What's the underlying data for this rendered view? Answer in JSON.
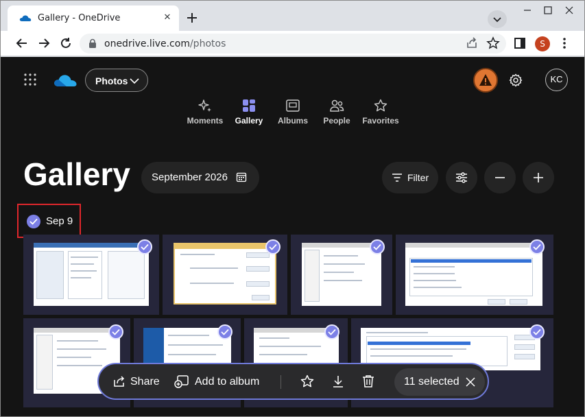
{
  "browser": {
    "tab_title": "Gallery - OneDrive",
    "tab_close_glyph": "✕",
    "url_host": "onedrive.live.com",
    "url_path": "/photos",
    "profile_initial": "S"
  },
  "app": {
    "switcher_label": "Photos",
    "account_initials": "KC",
    "alert_color": "#e07632",
    "accent_color": "#7c80e6"
  },
  "nav": {
    "items": [
      {
        "label": "Moments",
        "icon": "sparkle-icon"
      },
      {
        "label": "Gallery",
        "icon": "grid-icon",
        "active": true
      },
      {
        "label": "Albums",
        "icon": "album-icon"
      },
      {
        "label": "People",
        "icon": "people-icon"
      },
      {
        "label": "Favorites",
        "icon": "star-icon"
      }
    ]
  },
  "gallery": {
    "title": "Gallery",
    "date_filter": "September 2026",
    "filter_label": "Filter",
    "day_label": "Sep 9"
  },
  "action_bar": {
    "share_label": "Share",
    "add_to_album_label": "Add to album",
    "selected_label": "11 selected"
  }
}
